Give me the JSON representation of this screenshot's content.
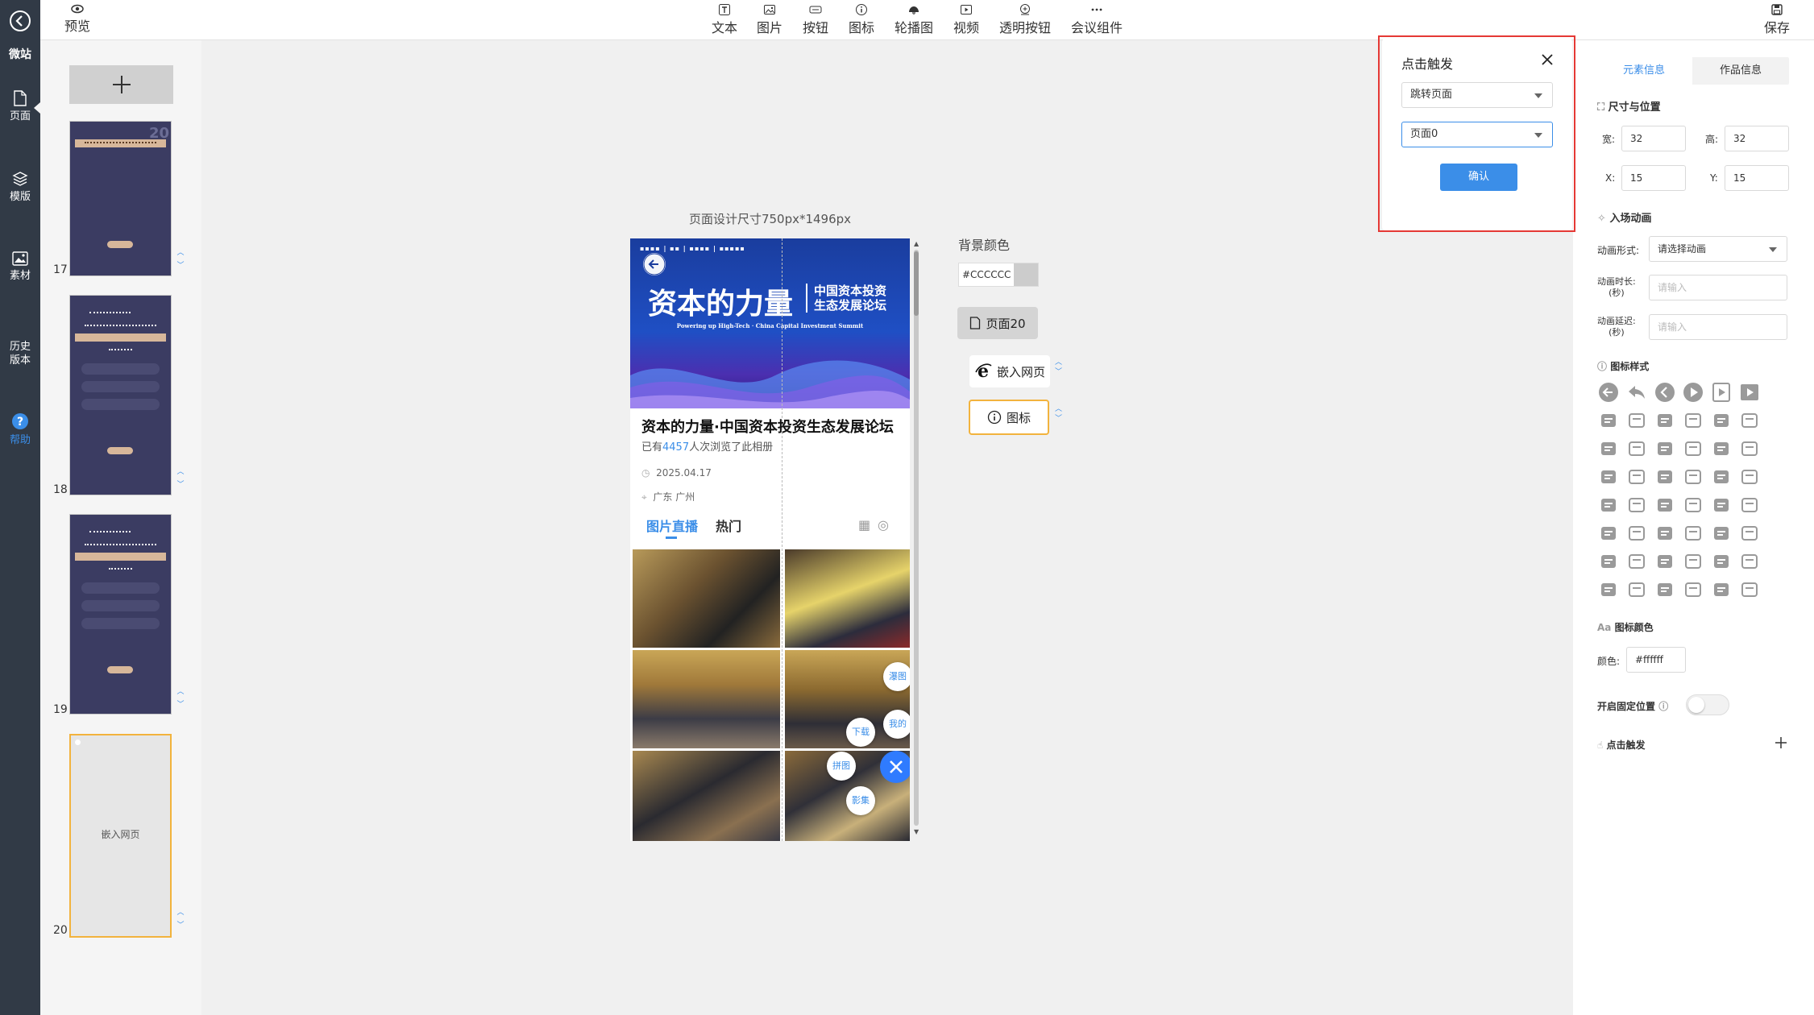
{
  "app": {
    "side_label": "微站"
  },
  "toolbar": {
    "preview_label": "预览",
    "save_label": "保存",
    "tools": [
      {
        "label": "文本",
        "icon": "text-icon"
      },
      {
        "label": "图片",
        "icon": "image-icon"
      },
      {
        "label": "按钮",
        "icon": "button-icon"
      },
      {
        "label": "图标",
        "icon": "info-icon"
      },
      {
        "label": "轮播图",
        "icon": "carousel-icon"
      },
      {
        "label": "视频",
        "icon": "video-icon"
      },
      {
        "label": "透明按钮",
        "icon": "transparent-button-icon"
      },
      {
        "label": "会议组件",
        "icon": "more-icon"
      }
    ]
  },
  "sidebar": {
    "items": [
      {
        "label": "页面",
        "icon": "page-icon"
      },
      {
        "label": "模版",
        "icon": "layers-icon"
      },
      {
        "label": "素材",
        "icon": "picture-icon"
      },
      {
        "label": "历史\n版本",
        "icon": "history-icon"
      },
      {
        "label": "帮助",
        "icon": "help-icon"
      }
    ]
  },
  "thumbnails": {
    "pages": [
      {
        "number": "17"
      },
      {
        "number": "18"
      },
      {
        "number": "19"
      },
      {
        "number": "20",
        "label": "嵌入网页"
      }
    ]
  },
  "canvas": {
    "size_label": "页面设计尺寸750px*1496px",
    "bg_label": "背景颜色",
    "bg_value": "#CCCCCC",
    "page_button": "页面20",
    "layers": [
      {
        "label": "嵌入网页",
        "icon": "ie-icon"
      },
      {
        "label": "图标",
        "icon": "info-icon"
      }
    ]
  },
  "phone": {
    "banner_title": "资本的力量",
    "banner_sub1": "中国资本投资",
    "banner_sub2": "生态发展论坛",
    "banner_en": "Powering up High-Tech · China Capital Investment Summit",
    "title": "资本的力量·中国资本投资生态发展论坛",
    "views_prefix": "已有",
    "views_count": "4457",
    "views_suffix": "人次浏览了此相册",
    "date": "2025.04.17",
    "location": "广东 广州",
    "tab_live": "图片直播",
    "tab_hot": "热门",
    "float_buttons": [
      "瀑图",
      "我的",
      "下载",
      "拼图",
      "影集"
    ]
  },
  "popup": {
    "title": "点击触发",
    "action_select": "跳转页面",
    "page_select": "页面0",
    "confirm": "确认"
  },
  "panel": {
    "tab_element": "元素信息",
    "tab_work": "作品信息",
    "size_pos_title": "尺寸与位置",
    "width_label": "宽:",
    "width": "32",
    "height_label": "高:",
    "height": "32",
    "x_label": "X:",
    "x": "15",
    "y_label": "Y:",
    "y": "15",
    "anim_title": "入场动画",
    "anim_form_label": "动画形式:",
    "anim_form_value": "请选择动画",
    "anim_duration_label": "动画时长:",
    "anim_duration_unit": "(秒)",
    "anim_delay_label": "动画延迟:",
    "anim_delay_unit": "(秒)",
    "placeholder_input": "请输入",
    "icon_style_title": "图标样式",
    "icon_color_title": "图标颜色",
    "color_label": "颜色:",
    "color_value": "#ffffff",
    "fixed_pos_label": "开启固定位置",
    "click_trigger_label": "点击触发"
  },
  "colors": {
    "nav_bg": "#313a46",
    "accent": "#3b8ee8",
    "highlight": "#e53935",
    "selected_border": "#f2b33d"
  }
}
